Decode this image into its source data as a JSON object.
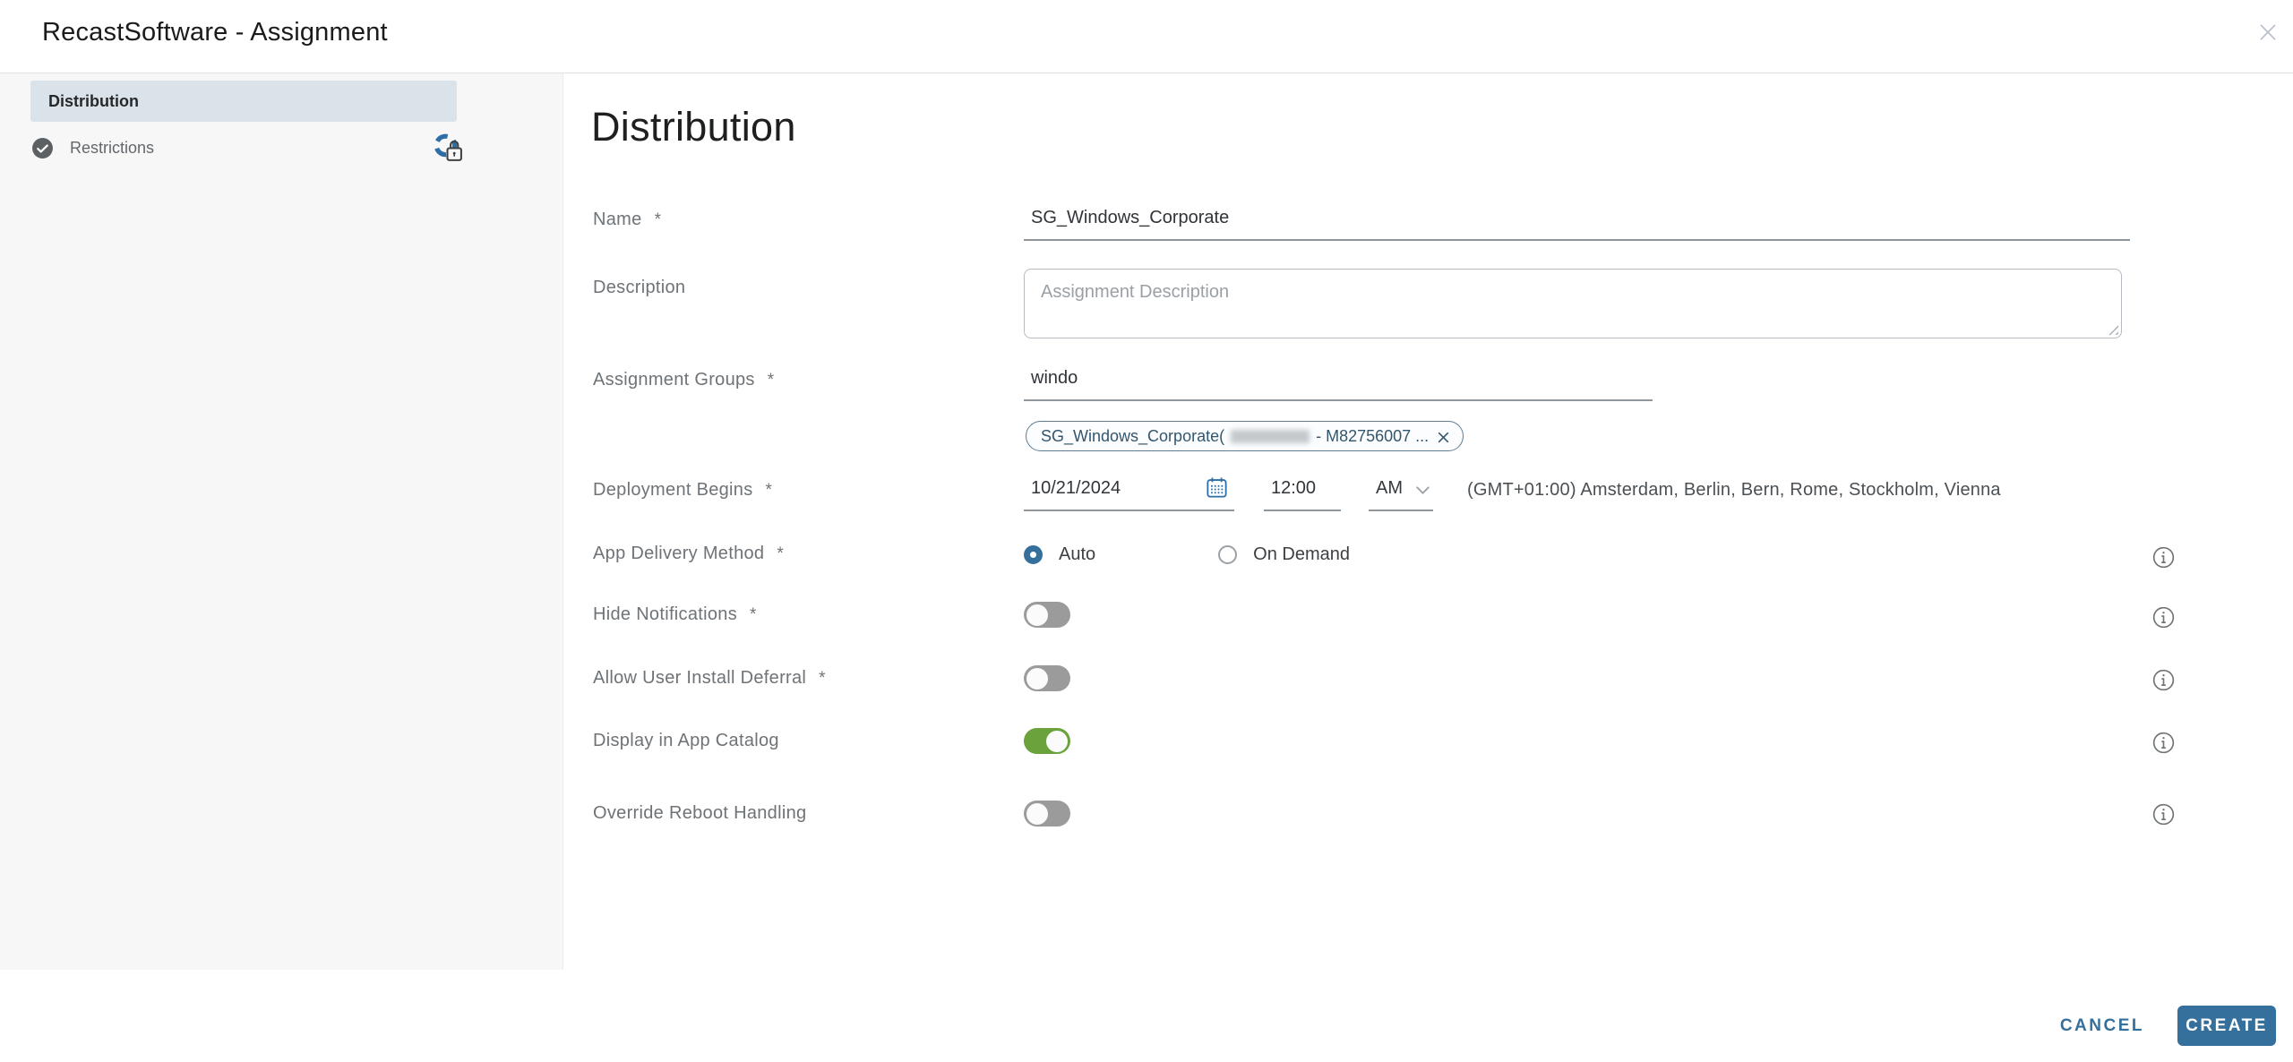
{
  "dialog": {
    "title": "RecastSoftware - Assignment"
  },
  "sidebar": {
    "items": [
      {
        "label": "Distribution",
        "active": true
      },
      {
        "label": "Restrictions",
        "active": false,
        "left_icon": "check-circle",
        "right_icon": "sync-lock"
      }
    ]
  },
  "main": {
    "heading": "Distribution",
    "fields": {
      "name": {
        "label": "Name",
        "required": true,
        "value": "SG_Windows_Corporate"
      },
      "description": {
        "label": "Description",
        "required": false,
        "value": "",
        "placeholder": "Assignment Description"
      },
      "assignment_groups": {
        "label": "Assignment Groups",
        "required": true,
        "value": "windo",
        "chip": {
          "text_prefix": "SG_Windows_Corporate(",
          "redacted_segment": "blurred",
          "text_suffix": "- M82756007 ...",
          "remove_icon": "x"
        }
      },
      "deployment_begins": {
        "label": "Deployment Begins",
        "required": true,
        "date": "10/21/2024",
        "time": "12:00",
        "meridiem": "AM",
        "timezone": "(GMT+01:00) Amsterdam, Berlin, Bern, Rome, Stockholm, Vienna"
      },
      "app_delivery_method": {
        "label": "App Delivery Method",
        "required": true,
        "options": [
          {
            "label": "Auto",
            "selected": true
          },
          {
            "label": "On Demand",
            "selected": false
          }
        ]
      },
      "hide_notifications": {
        "label": "Hide Notifications",
        "required": true,
        "on": false
      },
      "allow_user_install_deferral": {
        "label": "Allow User Install Deferral",
        "required": true,
        "on": false
      },
      "display_in_app_catalog": {
        "label": "Display in App Catalog",
        "required": false,
        "on": true
      },
      "override_reboot_handling": {
        "label": "Override Reboot Handling",
        "required": false,
        "on": false
      }
    }
  },
  "footer": {
    "cancel_label": "CANCEL",
    "create_label": "CREATE"
  },
  "ui": {
    "required_marker": "*"
  },
  "colors": {
    "accent": "#35709d",
    "toggle-on": "#6ba23c",
    "toggle-off": "#9b9b9b",
    "active-item-bg": "#dbe3ea",
    "sidebar-bg": "#f7f7f8",
    "chip-blue": "#33566e",
    "underline": "#8f979d"
  }
}
